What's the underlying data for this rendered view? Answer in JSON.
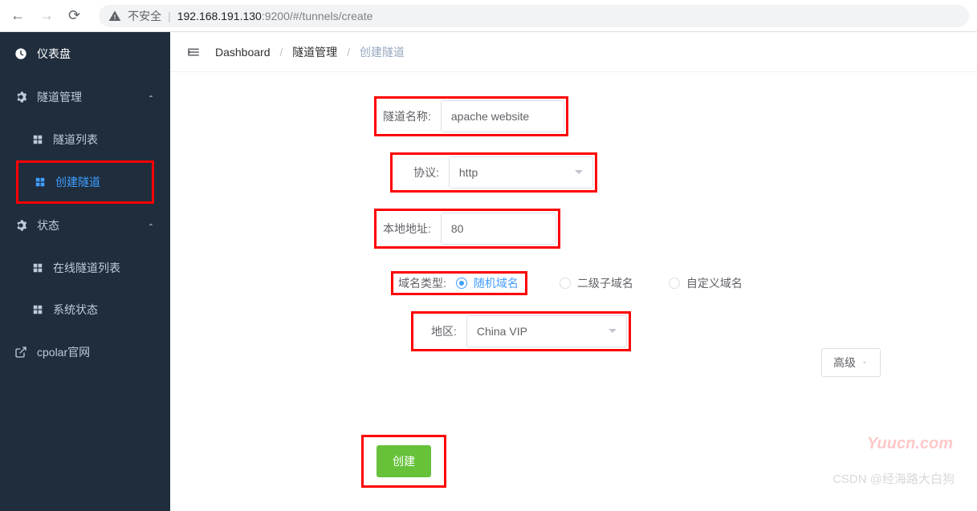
{
  "browser": {
    "security_label": "不安全",
    "url_host": "192.168.191.130",
    "url_port_path": ":9200/#/tunnels/create"
  },
  "sidebar": {
    "dashboard": "仪表盘",
    "tunnel_mgmt": "隧道管理",
    "tunnel_list": "隧道列表",
    "create_tunnel": "创建隧道",
    "status": "状态",
    "online_tunnels": "在线隧道列表",
    "system_status": "系统状态",
    "cpolar_site": "cpolar官网"
  },
  "breadcrumb": {
    "dashboard": "Dashboard",
    "tunnel_mgmt": "隧道管理",
    "create_tunnel": "创建隧道"
  },
  "form": {
    "tunnel_name_label": "隧道名称:",
    "tunnel_name_value": "apache website",
    "protocol_label": "协议:",
    "protocol_value": "http",
    "local_addr_label": "本地地址:",
    "local_addr_value": "80",
    "domain_type_label": "域名类型:",
    "domain_type_options": {
      "random": "随机域名",
      "sub": "二级子域名",
      "custom": "自定义域名"
    },
    "region_label": "地区:",
    "region_value": "China VIP",
    "advanced": "高级",
    "create_btn": "创建"
  },
  "watermark": "Yuucn.com",
  "csdn_mark": "CSDN @经海路大白狗"
}
